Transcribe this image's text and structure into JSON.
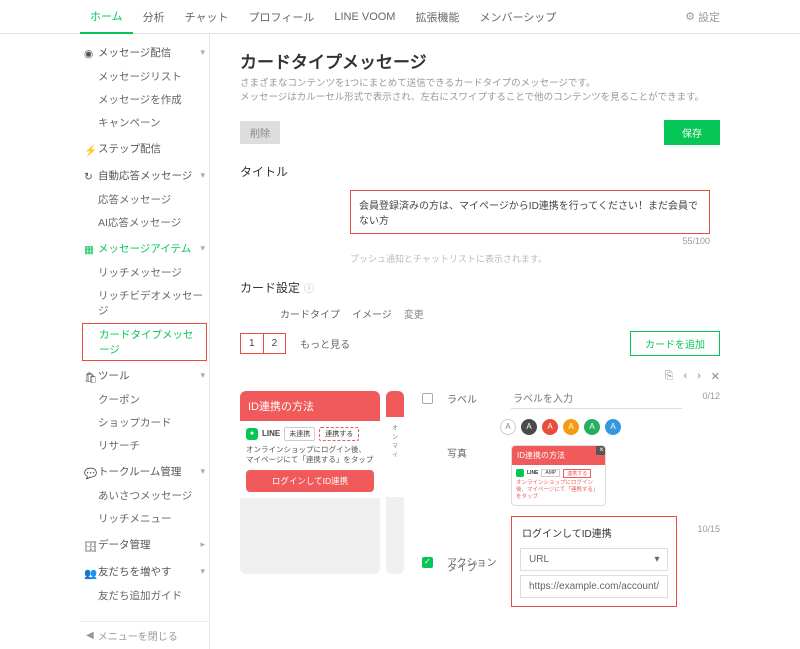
{
  "topnav": {
    "tabs": [
      "ホーム",
      "分析",
      "チャット",
      "プロフィール",
      "LINE VOOM",
      "拡張機能",
      "メンバーシップ"
    ],
    "settings": "設定"
  },
  "sidebar": {
    "groups": [
      {
        "head": "メッセージ配信",
        "items": [
          "メッセージリスト",
          "メッセージを作成",
          "キャンペーン"
        ]
      },
      {
        "head": "ステップ配信",
        "items": []
      },
      {
        "head": "自動応答メッセージ",
        "items": [
          "応答メッセージ",
          "AI応答メッセージ"
        ]
      },
      {
        "head": "メッセージアイテム",
        "green": true,
        "items": [
          "リッチメッセージ",
          "リッチビデオメッセージ",
          "カードタイプメッセージ"
        ]
      },
      {
        "head": "ツール",
        "items": [
          "クーポン",
          "ショップカード",
          "リサーチ"
        ]
      },
      {
        "head": "トークルーム管理",
        "items": [
          "あいさつメッセージ",
          "リッチメニュー"
        ]
      },
      {
        "head": "データ管理",
        "items": []
      },
      {
        "head": "友だちを増やす",
        "items": [
          "友だち追加ガイド"
        ]
      }
    ],
    "collapse": "メニューを閉じる"
  },
  "page": {
    "title": "カードタイプメッセージ",
    "desc1": "さまざまなコンテンツを1つにまとめて送信できるカードタイプのメッセージです。",
    "desc2": "メッセージはカルーセル形式で表示され、左右にスワイプすることで他のコンテンツを見ることができます。",
    "delete": "削除",
    "save": "保存",
    "titleLabel": "タイトル",
    "titleValue": "会員登録済みの方は、マイページからID連携を行ってください！まだ会員でない方",
    "titleCount": "55/100",
    "titleHint": "プッシュ通知とチャットリストに表示されます。",
    "cardSettings": "カード設定",
    "cardTypeLabel": "カードタイプ",
    "cardTypeValue": "イメージ",
    "change": "変更",
    "tab1": "1",
    "tab2": "2",
    "more": "もっと見る",
    "addCard": "カードを追加"
  },
  "preview": {
    "hdr": "ID連携の方法",
    "line": "LINE",
    "status": "未連携",
    "linkBtn": "連携する",
    "body1": "オンラインショップにログイン後、",
    "body2": "マイページにて「連携する」をタップ",
    "cta": "ログインしてID連携",
    "peek1": "オン",
    "peek2": "マイ"
  },
  "form": {
    "labelLabel": "ラベル",
    "labelPlaceholder": "ラベルを入力",
    "labelCount": "0/12",
    "photoLabel": "写真",
    "miniHdr": "ID連携の方法",
    "miniLine": "LINE",
    "miniAmp": "AMP",
    "miniLink": "連携する",
    "miniText": "オンラインショップにログイン後、マイページにて「連携する」をタップ",
    "actionLabel": "アクション",
    "actionValue": "ログインしてID連携",
    "actionCount": "10/15",
    "typeLabel": "タイプ",
    "urlOption": "URL",
    "urlValue": "https://example.com/account/login",
    "swatches": [
      "#fff",
      "#4a4a4a",
      "#e74c3c",
      "#f39c12",
      "#27ae60",
      "#3498db"
    ]
  }
}
